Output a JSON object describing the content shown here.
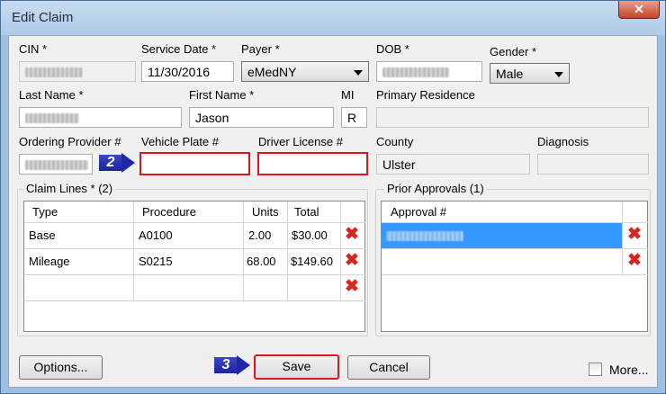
{
  "window": {
    "title": "Edit Claim",
    "close_glyph": "✕"
  },
  "form": {
    "cin": {
      "label": "CIN *",
      "value": ""
    },
    "service_date": {
      "label": "Service Date *",
      "value": "11/30/2016"
    },
    "payer": {
      "label": "Payer *",
      "value": "eMedNY"
    },
    "dob": {
      "label": "DOB *",
      "value": ""
    },
    "gender": {
      "label": "Gender *",
      "value": "Male"
    },
    "last_name": {
      "label": "Last Name *",
      "value": ""
    },
    "first_name": {
      "label": "First Name *",
      "value": "Jason"
    },
    "mi": {
      "label": "MI",
      "value": "R"
    },
    "primary_residence": {
      "label": "Primary Residence",
      "value": ""
    },
    "ordering_provider": {
      "label": "Ordering Provider #",
      "value": ""
    },
    "vehicle_plate": {
      "label": "Vehicle Plate #",
      "value": ""
    },
    "driver_license": {
      "label": "Driver License #",
      "value": ""
    },
    "county": {
      "label": "County",
      "value": "Ulster"
    },
    "diagnosis": {
      "label": "Diagnosis",
      "value": ""
    }
  },
  "claim_lines": {
    "title": "Claim Lines * (2)",
    "columns": [
      "Type",
      "Procedure",
      "Units",
      "Total"
    ],
    "rows": [
      {
        "type": "Base",
        "procedure": "A0100",
        "units": "2.00",
        "total": "$30.00"
      },
      {
        "type": "Mileage",
        "procedure": "S0215",
        "units": "68.00",
        "total": "$149.60"
      },
      {
        "type": "",
        "procedure": "",
        "units": "",
        "total": ""
      }
    ],
    "delete_glyph": "✖"
  },
  "prior_approvals": {
    "title": "Prior Approvals (1)",
    "columns": [
      "Approval #"
    ],
    "rows": [
      {
        "approval": ""
      },
      {
        "approval": ""
      }
    ],
    "delete_glyph": "✖"
  },
  "buttons": {
    "options": "Options...",
    "save": "Save",
    "cancel": "Cancel",
    "more": "More..."
  },
  "markers": {
    "vehicle": "2",
    "save": "3"
  },
  "colors": {
    "highlight_red": "#e0141e",
    "marker_blue": "#1f27a8",
    "selected_row": "#3399ff",
    "delete_red": "#d8251d"
  }
}
